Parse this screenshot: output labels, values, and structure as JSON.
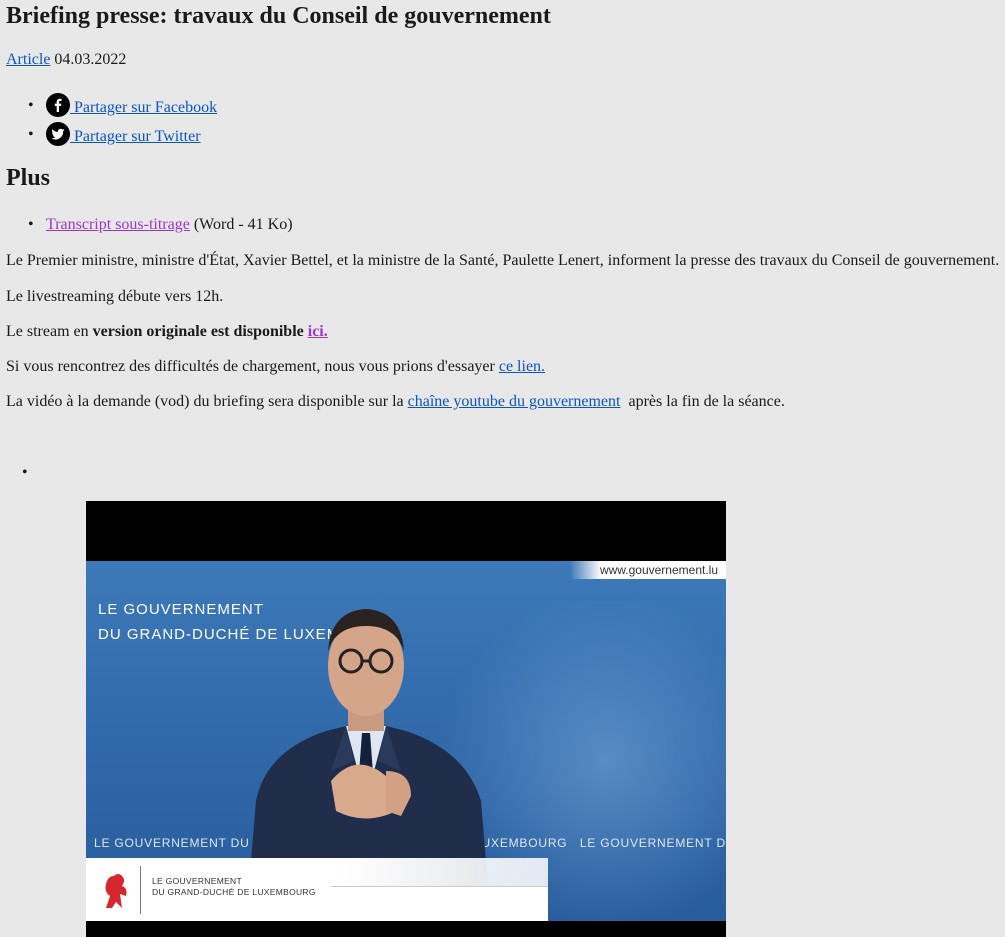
{
  "title": "Briefing presse: travaux du Conseil de gouvernement",
  "meta": {
    "category": "Article",
    "date": "04.03.2022"
  },
  "share": [
    {
      "label": "Partager sur Facebook",
      "icon": "facebook-icon"
    },
    {
      "label": "Partager sur Twitter",
      "icon": "twitter-icon"
    }
  ],
  "more": {
    "heading": "Plus",
    "link": "Transcript sous-titrage",
    "info": "(Word - 41 Ko)"
  },
  "body": {
    "intro": "Le Premier ministre, ministre d'État, Xavier Bettel, et la ministre de la Santé, Paulette Lenert, informent la presse des travaux du Conseil de gouvernement.",
    "livestream": "Le livestreaming débute vers 12h.",
    "stream_pre": "Le stream en ",
    "stream_bold": "version originale est disponible",
    "stream_link": "ici.",
    "trouble_pre": "Si vous rencontrez des difficultés de chargement, nous vous prions d'essayer ",
    "trouble_link": "ce lien.",
    "vod_pre": "La vidéo à la demande (vod) du briefing sera disponible sur la ",
    "vod_link": "chaîne youtube du gouvernement",
    "vod_post": "  après la fin de la séance."
  },
  "video": {
    "url_tag": "www.gouvernement.lu",
    "gov_line1": "LE GOUVERNEMENT",
    "gov_line2": "DU GRAND-DUCHÉ DE LUXEM",
    "ticker": "LE GOUVERNEMENT DU G                       RAND-DUCHÉ DE LUXEMBOURG   LE GOUVERNEMENT DU GRAND-DUCHÉ D",
    "lower_line1": "LE GOUVERNEMENT",
    "lower_line2": "DU GRAND-DUCHÉ DE LUXEMBOURG"
  },
  "colors": {
    "background": "#e8e8e8",
    "link": "#0a55c5",
    "visited_link": "#9a37c7"
  }
}
